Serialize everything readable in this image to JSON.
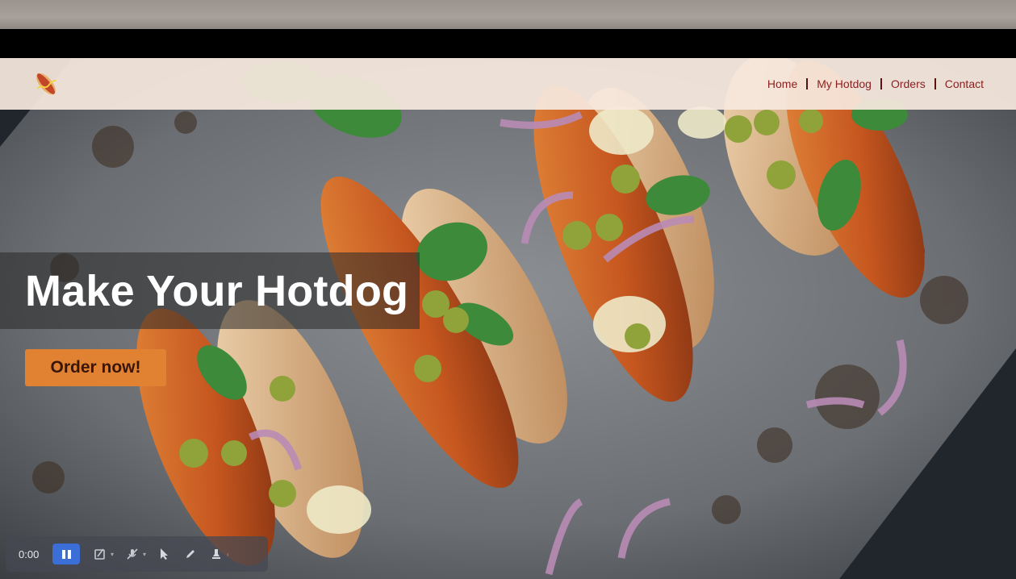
{
  "nav": {
    "logo_icon": "hotdog-icon",
    "items": [
      {
        "label": "Home"
      },
      {
        "label": "My Hotdog"
      },
      {
        "label": "Orders"
      },
      {
        "label": "Contact"
      }
    ]
  },
  "hero": {
    "headline": "Make Your Hotdog",
    "cta_label": "Order now!"
  },
  "recorder": {
    "time": "0:00",
    "tools": [
      "pause-icon",
      "draw-off-icon",
      "mic-off-icon",
      "pointer-icon",
      "pen-icon",
      "highlighter-icon"
    ]
  },
  "colors": {
    "nav_text": "#8a1f1f",
    "cta_bg": "#e08232",
    "recorder_accent": "#3c6ed8"
  }
}
